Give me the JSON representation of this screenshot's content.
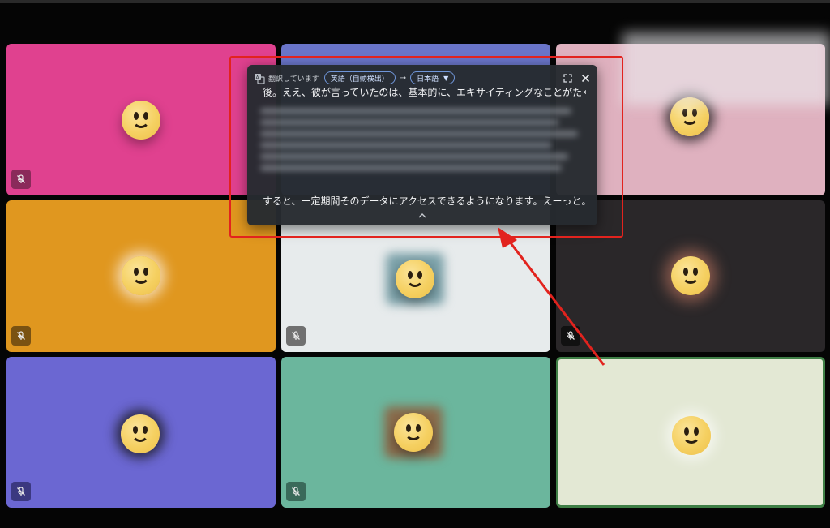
{
  "translation_panel": {
    "status": "翻訳しています",
    "source_language": "英語（自動検出）",
    "arrow": "→",
    "target_language": "日本語",
    "caption_first": "後。ええ、彼が言っていたのは、基本的に、エキサイティングなことがたくさんあるっ",
    "caption_last": "すると、一定期間そのデータにアクセスできるようになります。えーっと。どうやって"
  },
  "tiles": [
    {
      "color": "#e0418f",
      "mic_bg": "#8a2a5a"
    },
    {
      "color": "#6a75c9",
      "mic_bg": "#3f4784"
    },
    {
      "color": "#dfb1bf",
      "mic_bg": "#9b6c7a"
    },
    {
      "color": "#e0971f",
      "mic_bg": "#7a5212"
    },
    {
      "color": "#e7ebec",
      "mic_bg": "#707070"
    },
    {
      "color": "#2a2729",
      "mic_bg": "#111111"
    },
    {
      "color": "#6b67d2",
      "mic_bg": "#3b3880"
    },
    {
      "color": "#6bb69d",
      "mic_bg": "#3a6a5a"
    },
    {
      "color": "#e3e8d4",
      "mic_bg": "#9aa08a"
    }
  ],
  "icons": {
    "translate": "translate-icon",
    "maximize": "expand-icon",
    "close": "close-icon",
    "collapse": "chevron-up-icon",
    "mic_off": "mic-off-icon",
    "participant": "smiley-face-icon"
  },
  "colors": {
    "annotation": "#e2231e",
    "active_speaker_border": "#3f7f46",
    "chip_border": "#6f95d8"
  }
}
